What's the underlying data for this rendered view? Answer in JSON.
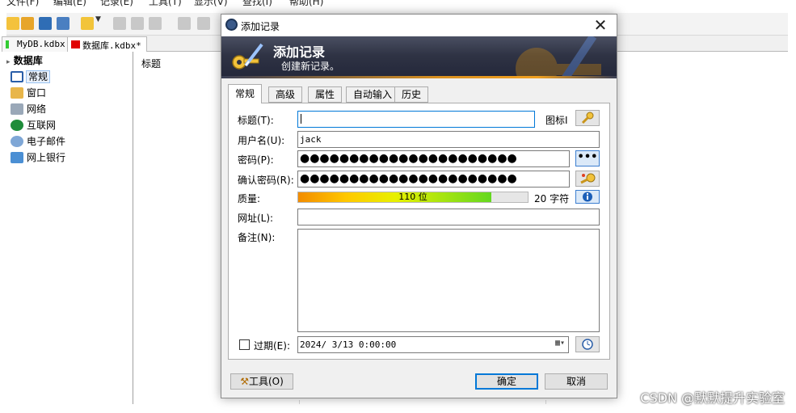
{
  "menubar": {
    "items": [
      "文件(F)",
      "编辑(E)",
      "记录(E)",
      "工具(T)",
      "显示(V)",
      "查找(I)",
      "帮助(H)"
    ]
  },
  "document_tabs": [
    {
      "label": "MyDB.kdbx",
      "color": "#33cc33"
    },
    {
      "label": "数据库.kdbx*",
      "color": "#e00000"
    }
  ],
  "tree": {
    "root": "数据库",
    "items": [
      "常规",
      "窗口",
      "网络",
      "互联网",
      "电子邮件",
      "网上银行"
    ],
    "selected": "常规"
  },
  "list": {
    "column_title": "标题"
  },
  "dialog": {
    "title": "添加记录",
    "banner_title": "添加记录",
    "banner_subtitle": "创建新记录。",
    "tabs": [
      "常规",
      "高级",
      "属性",
      "自动输入",
      "历史"
    ],
    "active_tab": "常规",
    "fields": {
      "title_label": "标题(T):",
      "title_value": "",
      "icon_label": "图标I",
      "username_label": "用户名(U):",
      "username_value": "jack",
      "password_label": "密码(P):",
      "password_value": "●●●●●●●●●●●●●●●●●●●●●●",
      "repeat_label": "确认密码(R):",
      "repeat_value": "●●●●●●●●●●●●●●●●●●●●●●",
      "quality_label": "质量:",
      "quality_text": "110 位",
      "quality_fraction": 0.84,
      "quality_chars": "20 字符",
      "url_label": "网址(L):",
      "url_value": "",
      "notes_label": "备注(N):",
      "notes_value": "",
      "expires_label": "过期(E):",
      "expires_checked": false,
      "expires_value": "2024/ 3/13   0:00:00"
    },
    "buttons": {
      "tools": "工具(O)",
      "ok": "确定",
      "cancel": "取消",
      "show_password": "•••"
    }
  },
  "watermark": "CSDN @默默提升实验室",
  "colors": {
    "banner_dark": "#2f3344",
    "accent_blue": "#0078d7",
    "quality_start": "#f28c00",
    "quality_end": "#64d820"
  }
}
